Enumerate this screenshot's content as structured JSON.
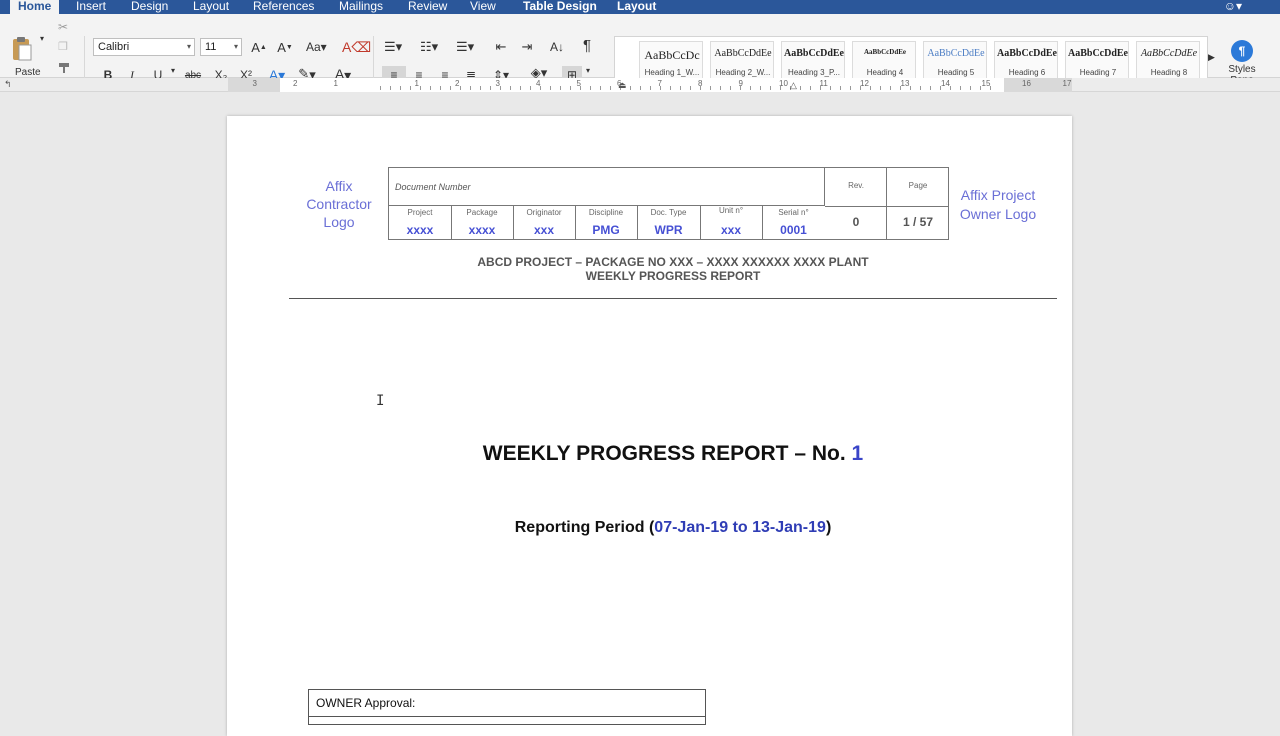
{
  "tabs": [
    {
      "label": "Home",
      "active": true
    },
    {
      "label": "Insert"
    },
    {
      "label": "Design"
    },
    {
      "label": "Layout"
    },
    {
      "label": "References"
    },
    {
      "label": "Mailings"
    },
    {
      "label": "Review"
    },
    {
      "label": "View"
    },
    {
      "label": "Table Design",
      "contextual": true
    },
    {
      "label": "Layout",
      "contextual": true
    }
  ],
  "ribbon": {
    "paste_label": "Paste",
    "font_name": "Calibri",
    "font_size": "11",
    "styles": [
      {
        "sample": "AaBbCcDc",
        "name": "Heading 1_W..."
      },
      {
        "sample": "AaBbCcDdEe",
        "name": "Heading 2_W..."
      },
      {
        "sample": "AaBbCcDdEe",
        "name": "Heading 3_P..."
      },
      {
        "sample": "AaBbCcDdEe",
        "name": "Heading 4"
      },
      {
        "sample": "AaBbCcDdEe",
        "name": "Heading 5"
      },
      {
        "sample": "AaBbCcDdEe",
        "name": "Heading 6"
      },
      {
        "sample": "AaBbCcDdEe",
        "name": "Heading 7"
      },
      {
        "sample": "AaBbCcDdEe",
        "name": "Heading 8"
      }
    ],
    "styles_pane_label": "Styles Pane",
    "bold": "B",
    "italic": "I",
    "underline": "U",
    "strike": "abc",
    "subscript": "X₂",
    "superscript": "X²",
    "pilcrow": "¶"
  },
  "ruler": {
    "numbers": [
      "3",
      "2",
      "1",
      "1",
      "2",
      "3",
      "4",
      "5",
      "6",
      "7",
      "8",
      "9",
      "10",
      "11",
      "12",
      "13",
      "14",
      "15",
      "16",
      "17"
    ]
  },
  "document": {
    "logo_left": "Affix Contractor Logo",
    "logo_right": "Affix Project Owner Logo",
    "header_table": {
      "doc_number_label": "Document Number",
      "columns": [
        {
          "label": "Project",
          "value": "xxxx"
        },
        {
          "label": "Package",
          "value": "xxxx"
        },
        {
          "label": "Originator",
          "value": "xxx"
        },
        {
          "label": "Discipline",
          "value": "PMG"
        },
        {
          "label": "Doc. Type",
          "value": "WPR"
        },
        {
          "label": "Unit n°",
          "value": "xxx"
        },
        {
          "label": "Serial n°",
          "value": "0001"
        }
      ],
      "rev_label": "Rev.",
      "rev_value": "0",
      "page_label": "Page",
      "page_value": "1 / 57"
    },
    "project_line1": "ABCD PROJECT – PACKAGE NO XXX – XXXX XXXXXX XXXX PLANT",
    "project_line2": "WEEKLY PROGRESS REPORT",
    "title_prefix": "WEEKLY PROGRESS REPORT – No. ",
    "title_number": "1",
    "period_prefix": "Reporting Period (",
    "period_dates": "07-Jan-19 to 13-Jan-19",
    "period_suffix": ")",
    "owner_approval": "OWNER Approval:"
  },
  "colors": {
    "ribbon_blue": "#2b579a",
    "logo_text": "#6a6fd6",
    "field_value": "#4650d4",
    "date_blue": "#2f3db5"
  }
}
